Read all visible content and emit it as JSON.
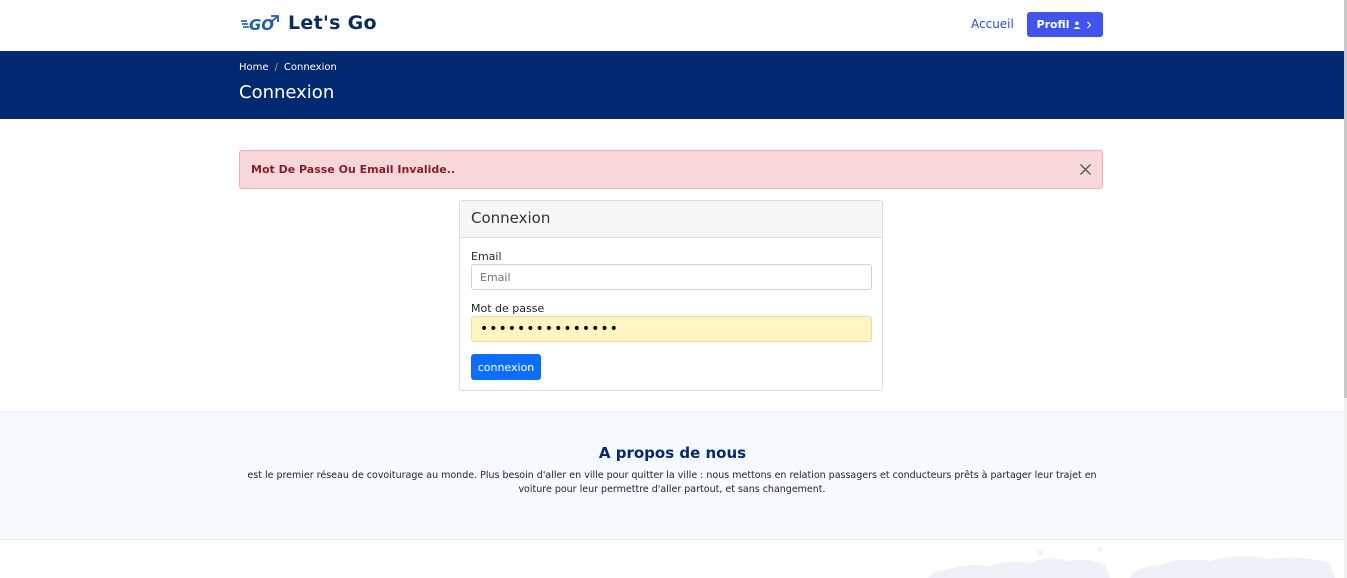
{
  "header": {
    "logo_text": "Let's Go",
    "logo_mark_text": "GO",
    "nav_home_label": "Accueil",
    "profile_button_label": "Profil"
  },
  "banner": {
    "breadcrumb": [
      "Home",
      "Connexion"
    ],
    "title": "Connexion"
  },
  "alert": {
    "message": "Mot De Passe Ou Email Invalide.."
  },
  "login_card": {
    "title": "Connexion",
    "email_label": "Email",
    "email_placeholder": "Email",
    "email_value": "",
    "password_label": "Mot de passe",
    "password_value": "•••••••••••••••",
    "submit_label": "connexion"
  },
  "about": {
    "title": "A propos de nous",
    "text": "est le premier réseau de covoiturage au monde. Plus besoin d'aller en ville pour quitter la ville : nous mettons en relation passagers et conducteurs prêts à partager leur trajet en voiture pour leur permettre d'aller partout, et sans changement."
  },
  "colors": {
    "brand_navy": "#012970",
    "accent_button": "#4154f1",
    "primary_button": "#0d6efd",
    "alert_bg": "#f8d7da",
    "alert_text": "#842029",
    "autofill_bg": "#fef5c3"
  }
}
